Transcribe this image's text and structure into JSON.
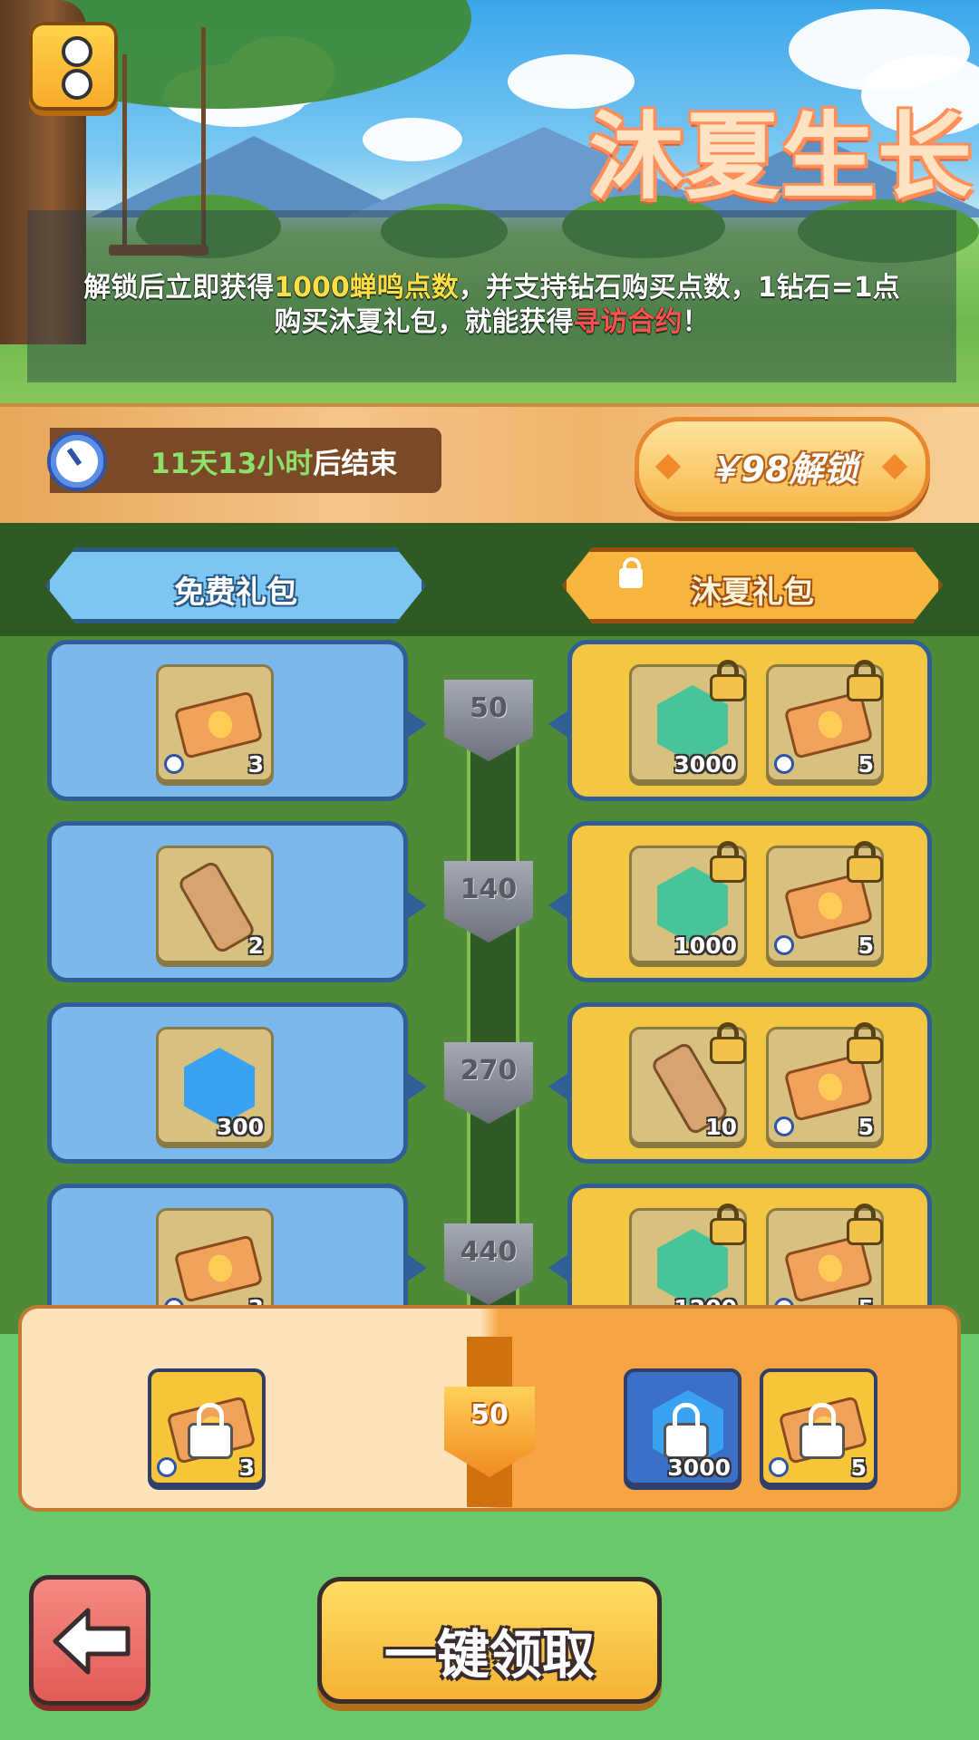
{
  "hero": {
    "title": "沐夏生长",
    "info_line1_a": "解锁后立即获得",
    "info_line1_hl": "1000蝉鸣点数",
    "info_line1_b": "，并支持钻石购买点数，1钻石=1点",
    "info_line2_a": "购买沐夏礼包，就能获得",
    "info_line2_hl": "寻访合约",
    "info_line2_b": "！"
  },
  "timer": {
    "remaining": "11天13小时",
    "suffix": "后结束"
  },
  "unlock_button": {
    "label": "￥98解锁"
  },
  "tabs": {
    "free": "免费礼包",
    "summer": "沐夏礼包"
  },
  "rows": [
    {
      "level": "50",
      "free": {
        "icon": "ticket-icon",
        "count": "3"
      },
      "paid": [
        {
          "icon": "green-gem-icon",
          "count": "3000"
        },
        {
          "icon": "ticket-icon",
          "count": "5"
        }
      ]
    },
    {
      "level": "140",
      "free": {
        "icon": "scroll-icon",
        "count": "2"
      },
      "paid": [
        {
          "icon": "green-gem-icon",
          "count": "1000"
        },
        {
          "icon": "ticket-icon",
          "count": "5"
        }
      ]
    },
    {
      "level": "270",
      "free": {
        "icon": "blue-gem-icon",
        "count": "300"
      },
      "paid": [
        {
          "icon": "scroll-icon",
          "count": "10"
        },
        {
          "icon": "ticket-icon",
          "count": "5"
        }
      ]
    },
    {
      "level": "440",
      "free": {
        "icon": "ticket-icon",
        "count": "3"
      },
      "paid": [
        {
          "icon": "green-gem-icon",
          "count": "1200"
        },
        {
          "icon": "ticket-icon",
          "count": "5"
        }
      ]
    }
  ],
  "current": {
    "level": "50",
    "free_count": "3",
    "paid_counts": [
      "3000",
      "5"
    ]
  },
  "bottom": {
    "claim_label": "一键领取"
  },
  "colors": {
    "free_card": "#7ab8ee",
    "paid_card": "#f4c742",
    "track": "#2f5a24"
  }
}
